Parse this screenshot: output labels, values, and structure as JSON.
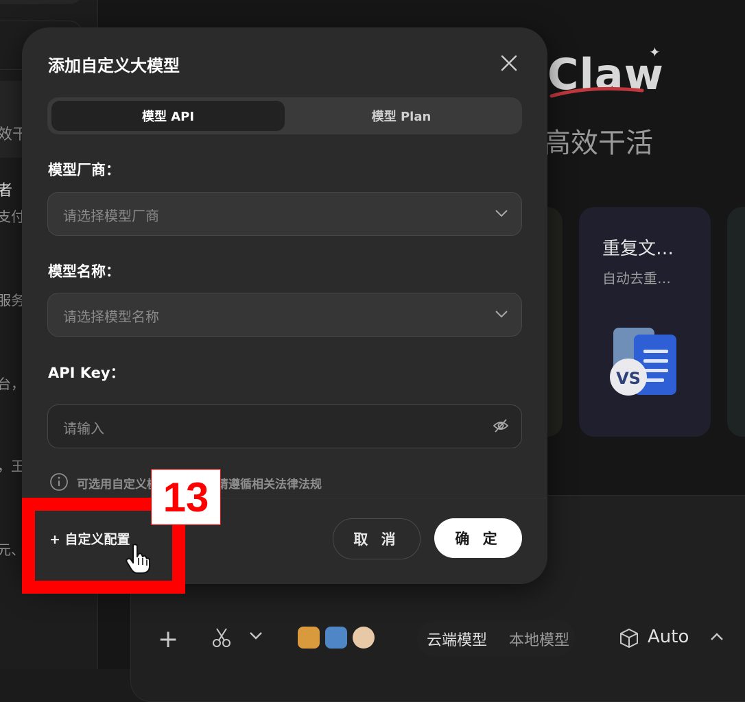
{
  "background": {
    "sidebar_fragments": [
      "效干",
      "者",
      "支付",
      "服务",
      "台，",
      "，王",
      "元、"
    ],
    "brand": "Claw",
    "subtitle": "高效干活",
    "card": {
      "title": "重复文…",
      "subtitle": "自动去重…",
      "illustration_icon": "document-compare-icon",
      "illustration_badge": "VS"
    },
    "toolbar": {
      "cloud_model": "云端模型",
      "local_model": "本地模型",
      "auto_label": "Auto"
    }
  },
  "modal": {
    "title": "添加自定义大模型",
    "tabs": [
      {
        "label": "模型 API",
        "active": true
      },
      {
        "label": "模型 Plan",
        "active": false
      }
    ],
    "vendor": {
      "label": "模型厂商：",
      "placeholder": "请选择模型厂商"
    },
    "model_name": {
      "label": "模型名称：",
      "placeholder": "请选择模型名称"
    },
    "api_key": {
      "label": "API Key：",
      "placeholder": "请输入"
    },
    "notice": "可选用自定义模型，使用时请遵循相关法律法规",
    "custom_config": "+ 自定义配置",
    "cancel": "取 消",
    "confirm": "确 定"
  },
  "annotation": {
    "step_number": "13",
    "color": "#ff0000"
  }
}
